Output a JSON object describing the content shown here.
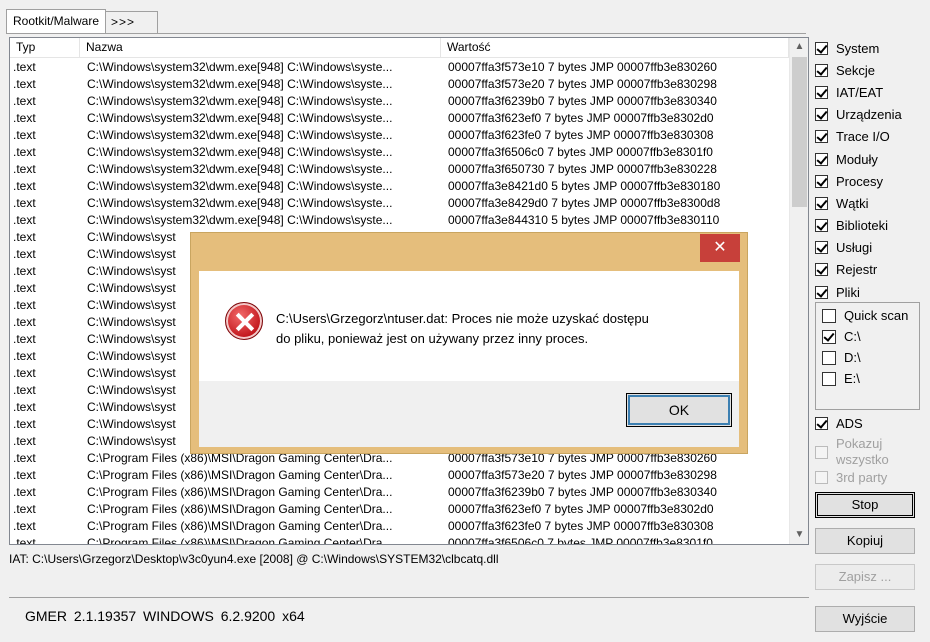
{
  "tabs": [
    {
      "label": "Rootkit/Malware",
      "active": true
    },
    {
      "label": ">>>",
      "active": false
    }
  ],
  "list": {
    "columns": [
      "Typ",
      "Nazwa",
      "Wartość"
    ],
    "rows": [
      [
        ".text",
        "C:\\Windows\\system32\\dwm.exe[948] C:\\Windows\\syste...",
        "00007ffa3f573e10 7 bytes JMP 00007ffb3e830260"
      ],
      [
        ".text",
        "C:\\Windows\\system32\\dwm.exe[948] C:\\Windows\\syste...",
        "00007ffa3f573e20 7 bytes JMP 00007ffb3e830298"
      ],
      [
        ".text",
        "C:\\Windows\\system32\\dwm.exe[948] C:\\Windows\\syste...",
        "00007ffa3f6239b0 7 bytes JMP 00007ffb3e830340"
      ],
      [
        ".text",
        "C:\\Windows\\system32\\dwm.exe[948] C:\\Windows\\syste...",
        "00007ffa3f623ef0 7 bytes JMP 00007ffb3e8302d0"
      ],
      [
        ".text",
        "C:\\Windows\\system32\\dwm.exe[948] C:\\Windows\\syste...",
        "00007ffa3f623fe0 7 bytes JMP 00007ffb3e830308"
      ],
      [
        ".text",
        "C:\\Windows\\system32\\dwm.exe[948] C:\\Windows\\syste...",
        "00007ffa3f6506c0 7 bytes JMP 00007ffb3e8301f0"
      ],
      [
        ".text",
        "C:\\Windows\\system32\\dwm.exe[948] C:\\Windows\\syste...",
        "00007ffa3f650730 7 bytes JMP 00007ffb3e830228"
      ],
      [
        ".text",
        "C:\\Windows\\system32\\dwm.exe[948] C:\\Windows\\syste...",
        "00007ffa3e8421d0 5 bytes JMP 00007ffb3e830180"
      ],
      [
        ".text",
        "C:\\Windows\\system32\\dwm.exe[948] C:\\Windows\\syste...",
        "00007ffa3e8429d0 7 bytes JMP 00007ffb3e8300d8"
      ],
      [
        ".text",
        "C:\\Windows\\system32\\dwm.exe[948] C:\\Windows\\syste...",
        "00007ffa3e844310 5 bytes JMP 00007ffb3e830110"
      ],
      [
        ".text",
        "C:\\Windows\\syst",
        ""
      ],
      [
        ".text",
        "C:\\Windows\\syst",
        ""
      ],
      [
        ".text",
        "C:\\Windows\\syst",
        ""
      ],
      [
        ".text",
        "C:\\Windows\\syst",
        ""
      ],
      [
        ".text",
        "C:\\Windows\\syst",
        ""
      ],
      [
        ".text",
        "C:\\Windows\\syst",
        ""
      ],
      [
        ".text",
        "C:\\Windows\\syst",
        ""
      ],
      [
        ".text",
        "C:\\Windows\\syst",
        ""
      ],
      [
        ".text",
        "C:\\Windows\\syst",
        ""
      ],
      [
        ".text",
        "C:\\Windows\\syst",
        ""
      ],
      [
        ".text",
        "C:\\Windows\\syst",
        ""
      ],
      [
        ".text",
        "C:\\Windows\\syst",
        ""
      ],
      [
        ".text",
        "C:\\Windows\\syst",
        ""
      ],
      [
        ".text",
        "C:\\Program Files (x86)\\MSI\\Dragon Gaming Center\\Dra...",
        "00007ffa3f573e10 7 bytes JMP 00007ffb3e830260"
      ],
      [
        ".text",
        "C:\\Program Files (x86)\\MSI\\Dragon Gaming Center\\Dra...",
        "00007ffa3f573e20 7 bytes JMP 00007ffb3e830298"
      ],
      [
        ".text",
        "C:\\Program Files (x86)\\MSI\\Dragon Gaming Center\\Dra...",
        "00007ffa3f6239b0 7 bytes JMP 00007ffb3e830340"
      ],
      [
        ".text",
        "C:\\Program Files (x86)\\MSI\\Dragon Gaming Center\\Dra...",
        "00007ffa3f623ef0 7 bytes JMP 00007ffb3e8302d0"
      ],
      [
        ".text",
        "C:\\Program Files (x86)\\MSI\\Dragon Gaming Center\\Dra...",
        "00007ffa3f623fe0 7 bytes JMP 00007ffb3e830308"
      ],
      [
        ".text",
        "C:\\Program Files (x86)\\MSI\\Dragon Gaming Center\\Dra...",
        "00007ffa3f6506c0 7 bytes JMP 00007ffb3e8301f0"
      ]
    ]
  },
  "status_line": "IAT: C:\\Users\\Grzegorz\\Desktop\\v3c0yun4.exe [2008] @ C:\\Windows\\SYSTEM32\\clbcatq.dll",
  "version": "GMER 2.1.19357    WINDOWS 6.2.9200  x64",
  "checks": [
    {
      "label": "System",
      "checked": true
    },
    {
      "label": "Sekcje",
      "checked": true
    },
    {
      "label": "IAT/EAT",
      "checked": true
    },
    {
      "label": "Urządzenia",
      "checked": true
    },
    {
      "label": "Trace I/O",
      "checked": true
    },
    {
      "label": "Moduły",
      "checked": true
    },
    {
      "label": "Procesy",
      "checked": true
    },
    {
      "label": "Wątki",
      "checked": true
    },
    {
      "label": "Biblioteki",
      "checked": true
    },
    {
      "label": "Usługi",
      "checked": true
    },
    {
      "label": "Rejestr",
      "checked": true
    },
    {
      "label": "Pliki",
      "checked": true
    }
  ],
  "drives": [
    {
      "label": "Quick scan",
      "checked": false
    },
    {
      "label": "C:\\",
      "checked": true
    },
    {
      "label": "D:\\",
      "checked": false
    },
    {
      "label": "E:\\",
      "checked": false
    }
  ],
  "ads": {
    "label": "ADS",
    "checked": true
  },
  "pokazuj": {
    "line1": "Pokazuj",
    "line2": "wszystko"
  },
  "third_party": "3rd party",
  "buttons": {
    "stop": "Stop",
    "kopiuj": "Kopiuj",
    "zapisz": "Zapisz ...",
    "wyjscie": "Wyjście"
  },
  "dialog": {
    "close": "✕",
    "line1": "C:\\Users\\Grzegorz\\ntuser.dat: Proces nie może uzyskać dostępu",
    "line2": "do pliku, ponieważ jest on używany przez inny proces.",
    "ok": "OK"
  },
  "scroll": {
    "up": "▲",
    "down": "▼"
  }
}
